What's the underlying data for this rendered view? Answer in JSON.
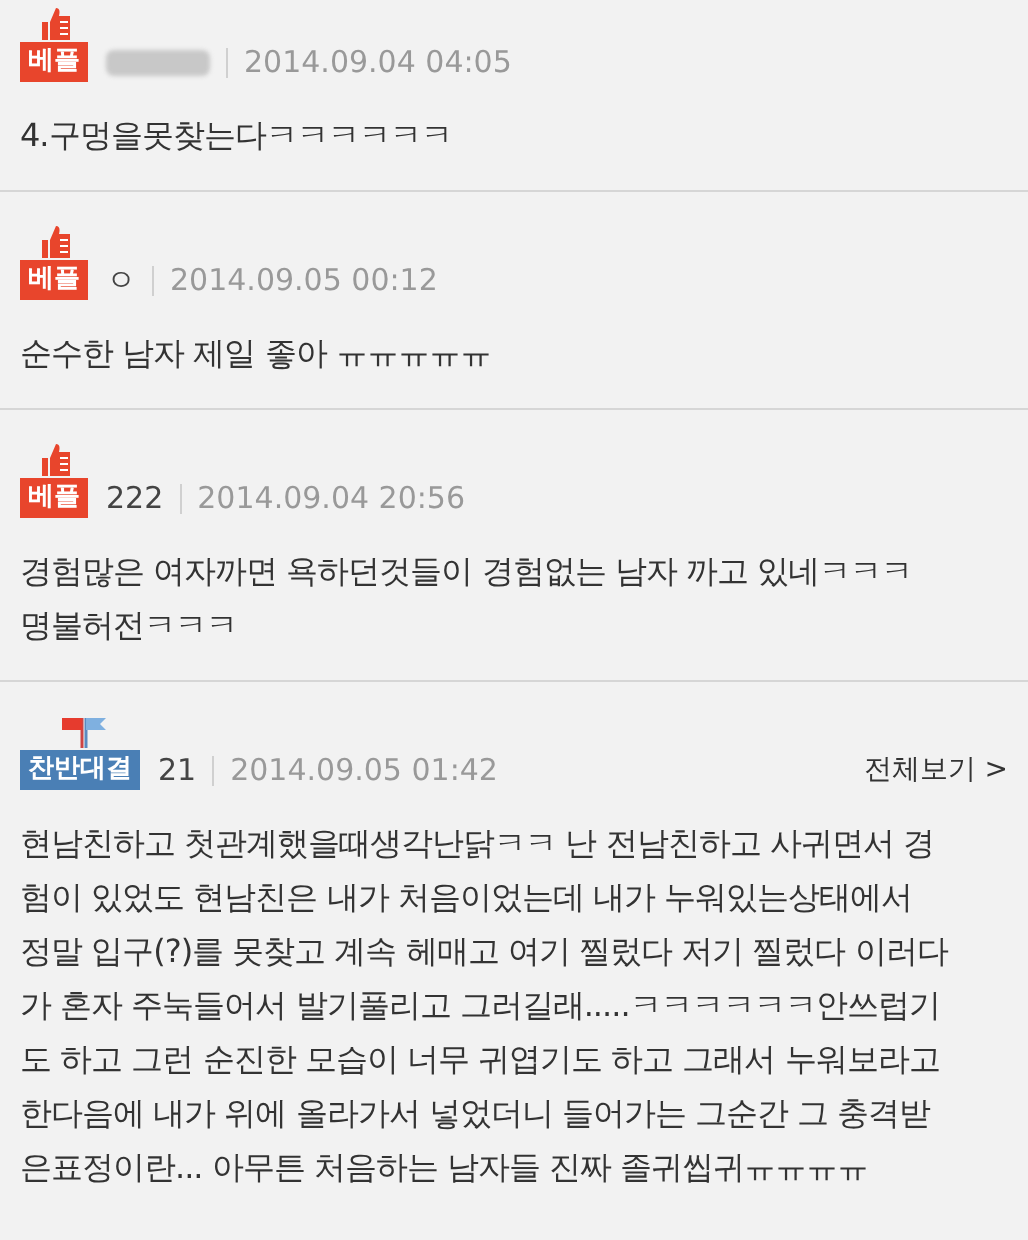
{
  "comments": [
    {
      "badge": {
        "kind": "best",
        "label": "베플"
      },
      "author_hidden": true,
      "date": "2014.09.04 04:05",
      "body": "4.구멍을못찾는다ㅋㅋㅋㅋㅋㅋ"
    },
    {
      "badge": {
        "kind": "best",
        "label": "베플"
      },
      "author": "ㅇ",
      "date": "2014.09.05 00:12",
      "body": "순수한 남자 제일 좋아 ㅠㅠㅠㅠㅠ"
    },
    {
      "badge": {
        "kind": "best",
        "label": "베플"
      },
      "author": "222",
      "date": "2014.09.04 20:56",
      "body": "경험많은 여자까면 욕하던것들이 경험없는 남자 까고 있네ㅋㅋㅋ\n명불허전ㅋㅋㅋ"
    },
    {
      "badge": {
        "kind": "versus",
        "label": "찬반대결"
      },
      "author": "21",
      "date": "2014.09.05 01:42",
      "more": "전체보기 >",
      "body": "현남친하고 첫관계했을때생각난닭ㅋㅋ 난 전남친하고 사귀면서 경\n험이 있었도 현남친은 내가 처음이었는데 내가 누워있는상태에서\n정말 입구(?)를 못찾고 계속 헤매고 여기 찔렀다 저기 찔렀다 이러다\n가 혼자 주눅들어서 발기풀리고 그러길래.....ㅋㅋㅋㅋㅋㅋ안쓰럽기\n도 하고 그런 순진한 모습이 너무 귀엽기도 하고 그래서 누워보라고\n한다음에 내가 위에 올라가서 넣었더니 들어가는 그순간 그 충격받\n은표정이란... 아무튼 처음하는 남자들 진짜 졸귀씹귀ㅠㅠㅠㅠ"
    }
  ]
}
